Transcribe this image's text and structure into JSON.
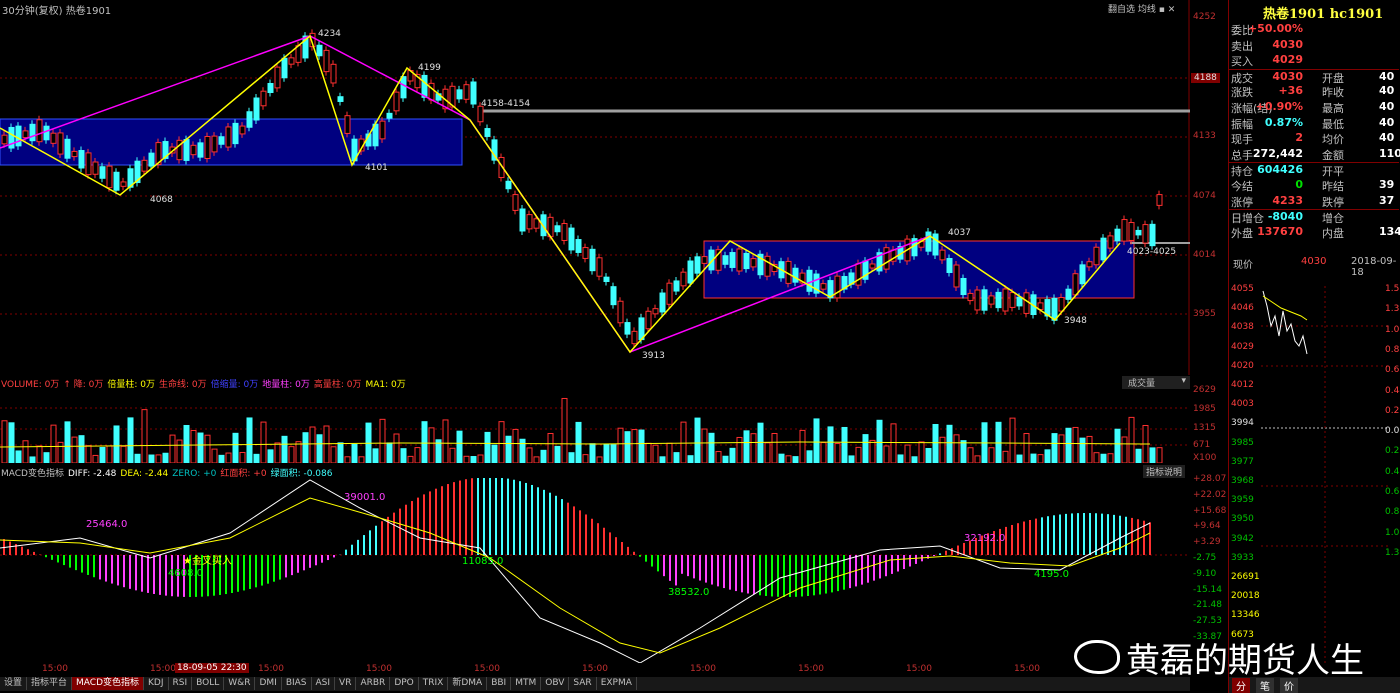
{
  "chart_header": {
    "period_label": "30分钟(复权)",
    "symbol": "热卷1901",
    "toolbar": [
      "翻自选",
      "均线"
    ]
  },
  "price_axis": [
    "4252",
    "4188",
    "4133",
    "4074",
    "4014",
    "3955"
  ],
  "annotations": {
    "high1": "4234",
    "peak2": "4199",
    "low1": "4068",
    "low2": "4101",
    "gap": "4158-4154",
    "low3": "3913",
    "peak3": "4037",
    "low4": "3948",
    "gap2": "4023-4025"
  },
  "volume_header": {
    "items": [
      {
        "label": "VOLUME: 0万",
        "color": "#ff4040"
      },
      {
        "label": "↑ 降: 0万",
        "color": "#ff4040"
      },
      {
        "label": "倍量柱: 0万",
        "color": "#ffff00"
      },
      {
        "label": "生命线: 0万",
        "color": "#ff4040"
      },
      {
        "label": "倍缩量: 0万",
        "color": "#4040ff"
      },
      {
        "label": "地量柱: 0万",
        "color": "#ff40ff"
      },
      {
        "label": "高量柱: 0万",
        "color": "#ff4040"
      },
      {
        "label": "MA1: 0万",
        "color": "#ffff00"
      }
    ],
    "dropdown": "成交量"
  },
  "volume_axis": [
    "2629",
    "1985",
    "1315",
    "671",
    "X100"
  ],
  "macd_header": {
    "items": [
      {
        "label": "MACD变色指标",
        "color": "#c0c0c0"
      },
      {
        "label": "DIFF: -2.48",
        "color": "#ffffff"
      },
      {
        "label": "DEA: -2.44",
        "color": "#ffff00"
      },
      {
        "label": "ZERO: +0",
        "color": "#00c0c0"
      },
      {
        "label": "红面积: +0",
        "color": "#ff4040"
      },
      {
        "label": "绿面积: -0.086",
        "color": "#40ffff"
      }
    ],
    "help_button": "指标说明"
  },
  "macd_axis": [
    "+28.07",
    "+22.02",
    "+15.68",
    "+9.64",
    "+3.29",
    "-2.75",
    "-9.10",
    "-15.14",
    "-21.48",
    "-27.53",
    "-33.87"
  ],
  "macd_annotations": {
    "a1": "25464.0",
    "a2": "39001.0",
    "a3": "4608.0",
    "a4": "11085.0",
    "a5": "38532.0",
    "a6": "32192.0",
    "a7": "4195.0",
    "signal": "金叉买入"
  },
  "time_axis": [
    "15:00",
    "15:00",
    "15:00",
    "15:00",
    "15:00",
    "15:00",
    "15:00",
    "15:00",
    "15:00",
    "15:00"
  ],
  "time_cursor": "18-09-05 22:30",
  "tabs": [
    "设置",
    "指标平台",
    "MACD变色指标",
    "KDJ",
    "RSI",
    "BOLL",
    "W&R",
    "DMI",
    "BIAS",
    "ASI",
    "VR",
    "ARBR",
    "DPO",
    "TRIX",
    "新DMA",
    "BBI",
    "MTM",
    "OBV",
    "SAR",
    "EXPMA"
  ],
  "active_tab": "MACD变色指标",
  "panel": {
    "title": "热卷1901 hc1901",
    "rows": [
      {
        "k": "委比",
        "v": "+50.00%",
        "vc": "red"
      },
      {
        "k": "卖出",
        "v": "4030",
        "vc": "red"
      },
      {
        "k": "买入",
        "v": "4029",
        "vc": "red"
      },
      {
        "k": "成交",
        "v": "4030",
        "vc": "red",
        "k2": "开盘",
        "v2": "40"
      },
      {
        "k": "涨跌",
        "v": "+36",
        "vc": "red",
        "k2": "昨收",
        "v2": "40"
      },
      {
        "k": "涨幅(结)",
        "v": "+0.90%",
        "vc": "red",
        "k2": "最高",
        "v2": "40"
      },
      {
        "k": "振幅",
        "v": "0.87%",
        "vc": "cyan",
        "k2": "最低",
        "v2": "40"
      },
      {
        "k": "现手",
        "v": "2",
        "vc": "red",
        "k2": "均价",
        "v2": "40"
      },
      {
        "k": "总手",
        "v": "272,442",
        "vc": "white",
        "k2": "金额",
        "v2": "110.1"
      },
      {
        "k": "持仓",
        "v": "604426",
        "vc": "cyan",
        "k2": "开平",
        "v2": ""
      },
      {
        "k": "今结",
        "v": "0",
        "vc": "green",
        "k2": "昨结",
        "v2": "39"
      },
      {
        "k": "涨停",
        "v": "4233",
        "vc": "red",
        "k2": "跌停",
        "v2": "37"
      },
      {
        "k": "日增仓",
        "v": "-8040",
        "vc": "cyan",
        "k2": "增仓",
        "v2": ""
      },
      {
        "k": "外盘",
        "v": "137670",
        "vc": "red",
        "k2": "内盘",
        "v2": "1347"
      }
    ],
    "mini": {
      "label": "现价",
      "price": "4030",
      "date": "2018-09-18",
      "left_axis": [
        "4055",
        "4046",
        "4038",
        "4029",
        "4020",
        "4012",
        "4003",
        "3994",
        "3985",
        "3977",
        "3968",
        "3959",
        "3950",
        "3942",
        "3933",
        "26691",
        "20018",
        "13346",
        "6673"
      ],
      "right_axis": [
        "1.53",
        "1.31",
        "1.09",
        "0.88",
        "0.66",
        "0.44",
        "0.22",
        "0.00",
        "0.21",
        "0.43",
        "0.65",
        "0.87",
        "1.09",
        "1.30"
      ]
    },
    "bottom_tabs": [
      "分",
      "笔",
      "价"
    ]
  },
  "watermark": "黄磊的期货人生",
  "colors": {
    "up": "#ff3030",
    "down": "#40ffff",
    "box": "#000080",
    "zigzag": "#ffff00",
    "trend": "#ff00ff"
  }
}
